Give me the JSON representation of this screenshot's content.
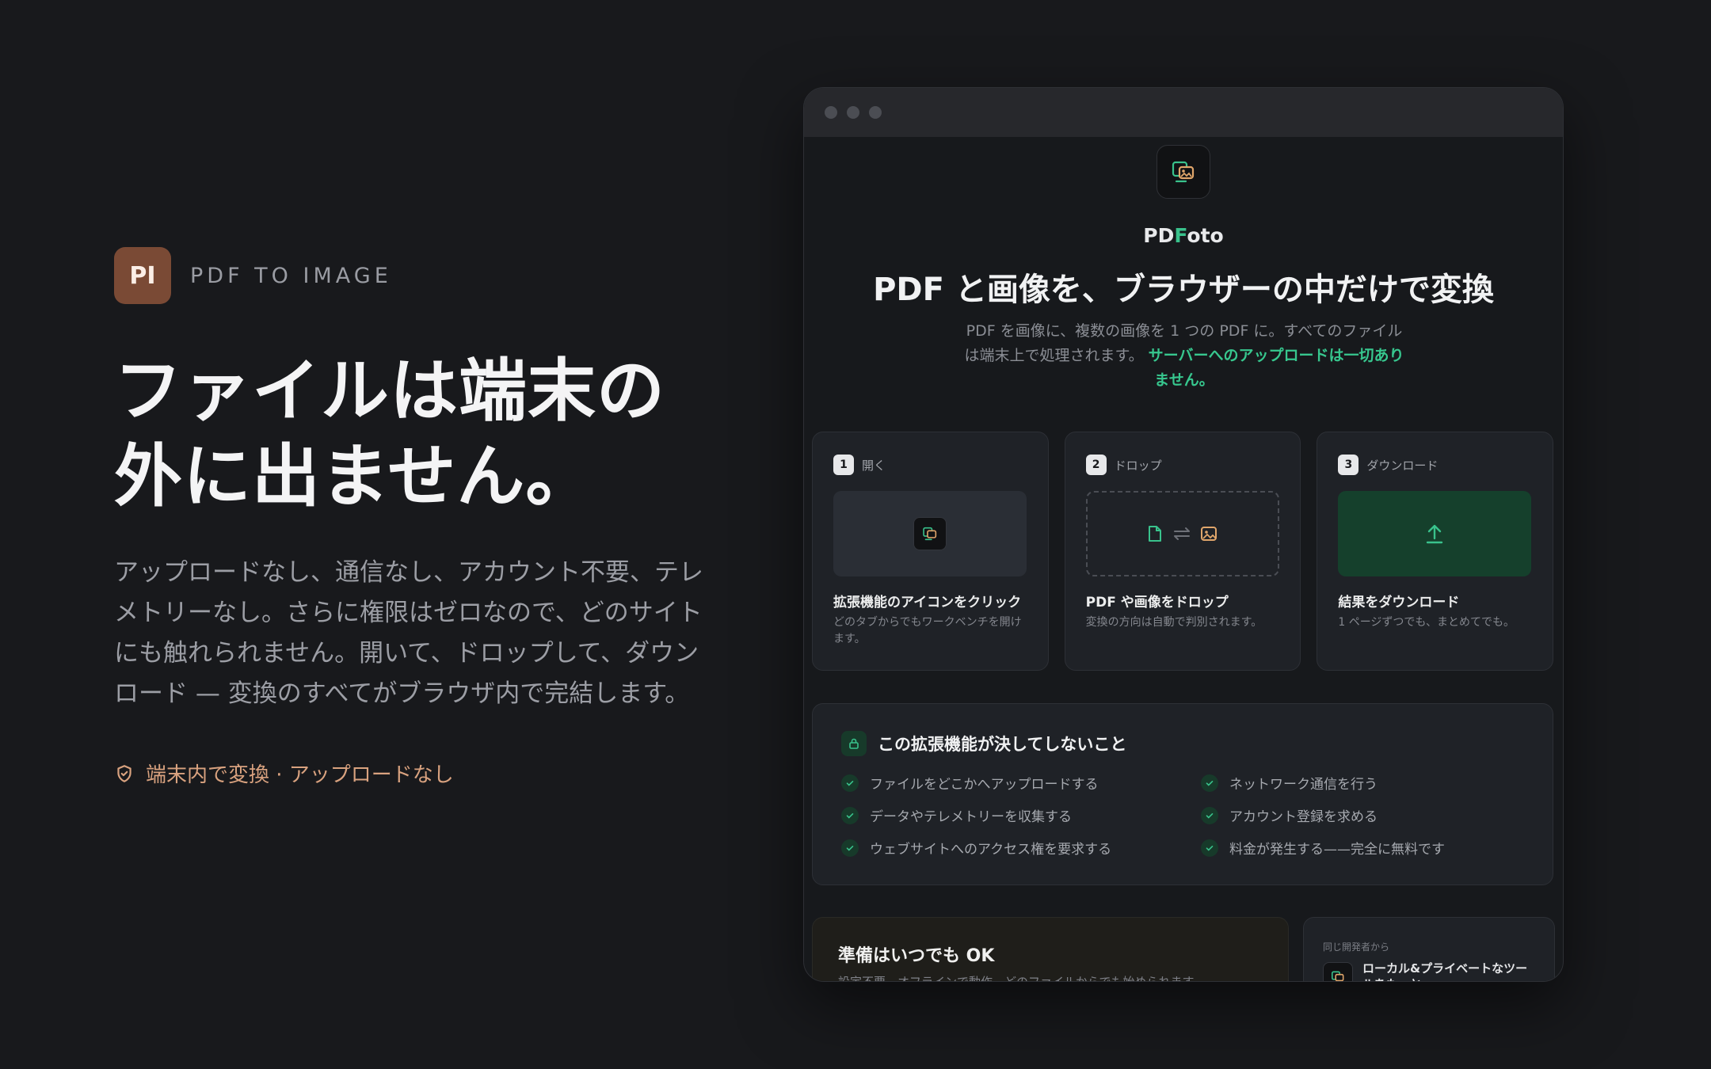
{
  "hero": {
    "logo": "PI",
    "tag": "PDF TO IMAGE",
    "title_line1": "ファイルは端末の",
    "title_line2": "外に出ません。",
    "body": "アップロードなし、通信なし、アカウント不要、テレメトリーなし。さらに権限はゼロなので、どのサイトにも触れられません。開いて、ドロップして、ダウンロード — 変換のすべてがブラウザ内で完結します。",
    "badge": "端末内で変換 · アップロードなし",
    "badge_icon": "shield-check-icon"
  },
  "app": {
    "name_part1": "PD",
    "name_part2": "F",
    "name_part3": "oto",
    "title": "PDF と画像を、ブラウザーの中だけで変換",
    "subtitle": "PDF を画像に、複数の画像を 1 つの PDF に。すべてのファイルは端末上で処理されます。",
    "subtitle_highlight": "サーバーへのアップロードは一切ありません。"
  },
  "steps": [
    {
      "num": "1",
      "label": "開く",
      "title": "拡張機能のアイコンをクリック",
      "desc": "どのタブからでもワークベンチを開けます。"
    },
    {
      "num": "2",
      "label": "ドロップ",
      "title": "PDF や画像をドロップ",
      "desc": "変換の方向は自動で判別されます。"
    },
    {
      "num": "3",
      "label": "ダウンロード",
      "title": "結果をダウンロード",
      "desc": "1 ページずつでも、まとめてでも。"
    }
  ],
  "never": {
    "title": "この拡張機能が決してしないこと",
    "items": [
      "ファイルをどこかへアップロードする",
      "ネットワーク通信を行う",
      "データやテレメトリーを収集する",
      "アカウント登録を求める",
      "ウェブサイトへのアクセス権を要求する",
      "料金が発生する——完全に無料です"
    ]
  },
  "ready": {
    "title": "準備はいつでも OK",
    "subtitle": "設定不要、オフラインで動作。どのファイルからでも始められます。"
  },
  "more": {
    "caption": "同じ開発者から",
    "title": "ローカル&プライベートなツールをもっと"
  },
  "colors": {
    "accent_green": "#39c28c",
    "brand_brown": "#7a4a35",
    "badge_orange": "#d9a27f"
  }
}
